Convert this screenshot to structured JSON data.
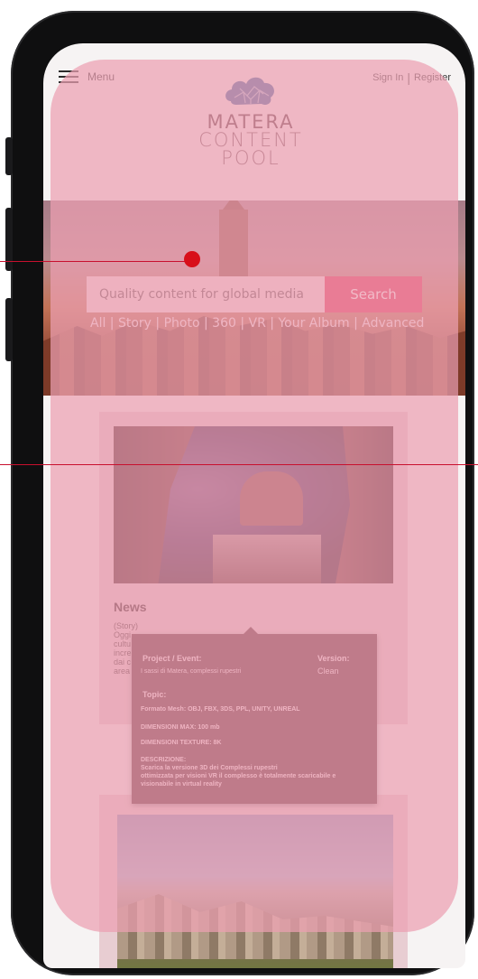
{
  "header": {
    "menu_label": "Menu",
    "sign_in": "Sign In",
    "separator": "|",
    "register": "Register"
  },
  "logo": {
    "line1": "MATERA",
    "line2": "CONTENT",
    "line3": "POOL"
  },
  "search": {
    "placeholder": "Quality content for global media",
    "button": "Search"
  },
  "filters": [
    "All",
    "Story",
    "Photo",
    "360",
    "VR",
    "Your Album",
    "Advanced"
  ],
  "card": {
    "title": "News",
    "category": "(Story)",
    "text_fragments": [
      "Oggi",
      "cultu",
      "incre",
      "dai c",
      "area"
    ]
  },
  "popup": {
    "project_label": "Project / Event:",
    "project_value": "I sassi di Matera, complessi rupestri",
    "version_label": "Version:",
    "version_value": "Clean",
    "topic_label": "Topic:",
    "format": "Formato Mesh: OBJ, FBX, 3DS, PPL, UNITY,  UNREAL",
    "dim_max": "DIMENSIONI MAX:  100 mb",
    "dim_texture": "DIMENSIONI TEXTURE:  8K",
    "desc_label": "DESCRIZIONE:",
    "desc_line1": "Scarica la versione 3D dei Complessi rupestri",
    "desc_line2": "ottimizzata per visioni VR il complesso è totalmente scaricabile e",
    "desc_line3": "visionabile in virtual reality"
  },
  "colors": {
    "accent": "#e0224c",
    "overlay": "#eca0b2",
    "popup_bg": "#4b1d26",
    "annotation": "#d80f1a"
  }
}
